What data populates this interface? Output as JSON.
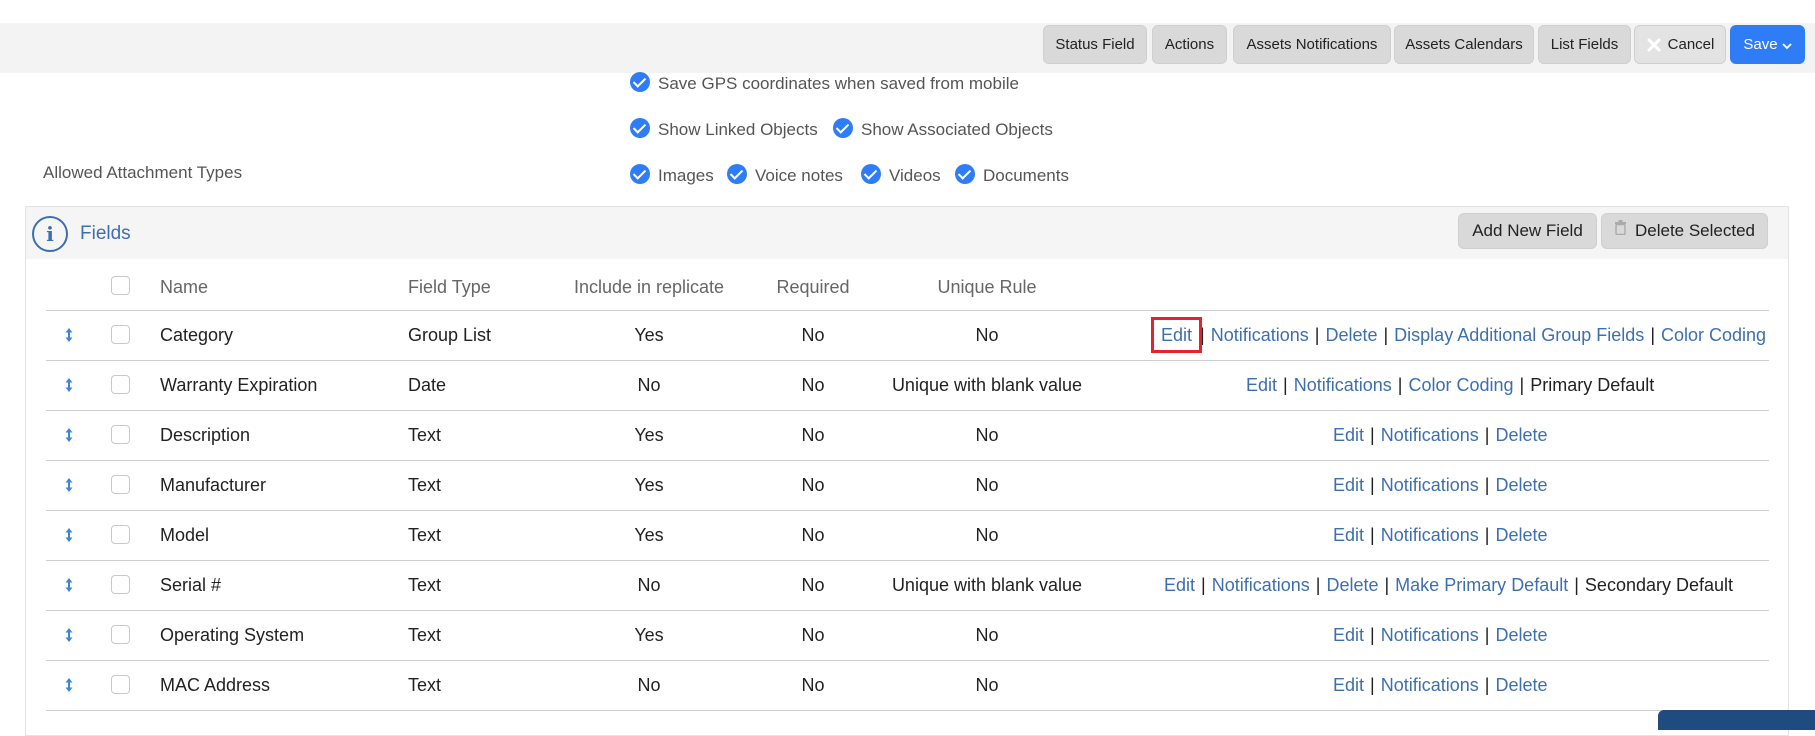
{
  "toolbar": {
    "buttons": [
      {
        "label": "Status Field"
      },
      {
        "label": "Actions"
      },
      {
        "label": "Assets Notifications"
      },
      {
        "label": "Assets Calendars"
      },
      {
        "label": "List Fields"
      }
    ],
    "cancel_label": "Cancel",
    "save_label": "Save"
  },
  "options": {
    "gps": "Save GPS coordinates when saved from mobile",
    "linked": "Show Linked Objects",
    "associated": "Show Associated Objects",
    "attachment_label": "Allowed Attachment Types",
    "attachment_types": [
      "Images",
      "Voice notes",
      "Videos",
      "Documents"
    ]
  },
  "fields_panel": {
    "title": "Fields",
    "add_label": "Add New Field",
    "delete_label": "Delete Selected"
  },
  "table": {
    "headers": {
      "name": "Name",
      "field_type": "Field Type",
      "replicate": "Include in replicate",
      "required": "Required",
      "unique": "Unique Rule"
    },
    "rows": [
      {
        "name": "Category",
        "type": "Group List",
        "replicate": "Yes",
        "required": "No",
        "unique": "No",
        "actions": [
          "Edit",
          "Notifications",
          "Delete",
          "Display Additional Group Fields",
          "Color Coding"
        ]
      },
      {
        "name": "Warranty Expiration",
        "type": "Date",
        "replicate": "No",
        "required": "No",
        "unique": "Unique with blank value",
        "actions": [
          "Edit",
          "Notifications",
          "Color Coding"
        ],
        "suffix": "Primary Default"
      },
      {
        "name": "Description",
        "type": "Text",
        "replicate": "Yes",
        "required": "No",
        "unique": "No",
        "actions": [
          "Edit",
          "Notifications",
          "Delete"
        ]
      },
      {
        "name": "Manufacturer",
        "type": "Text",
        "replicate": "Yes",
        "required": "No",
        "unique": "No",
        "actions": [
          "Edit",
          "Notifications",
          "Delete"
        ]
      },
      {
        "name": "Model",
        "type": "Text",
        "replicate": "Yes",
        "required": "No",
        "unique": "No",
        "actions": [
          "Edit",
          "Notifications",
          "Delete"
        ]
      },
      {
        "name": "Serial #",
        "type": "Text",
        "replicate": "No",
        "required": "No",
        "unique": "Unique with blank value",
        "actions": [
          "Edit",
          "Notifications",
          "Delete",
          "Make Primary Default"
        ],
        "suffix": "Secondary Default"
      },
      {
        "name": "Operating System",
        "type": "Text",
        "replicate": "Yes",
        "required": "No",
        "unique": "No",
        "actions": [
          "Edit",
          "Notifications",
          "Delete"
        ]
      },
      {
        "name": "MAC Address",
        "type": "Text",
        "replicate": "No",
        "required": "No",
        "unique": "No",
        "actions": [
          "Edit",
          "Notifications",
          "Delete"
        ]
      }
    ]
  },
  "colors": {
    "accent": "#2f7df6",
    "link": "#3d6fb0",
    "highlight": "#e0262c"
  }
}
